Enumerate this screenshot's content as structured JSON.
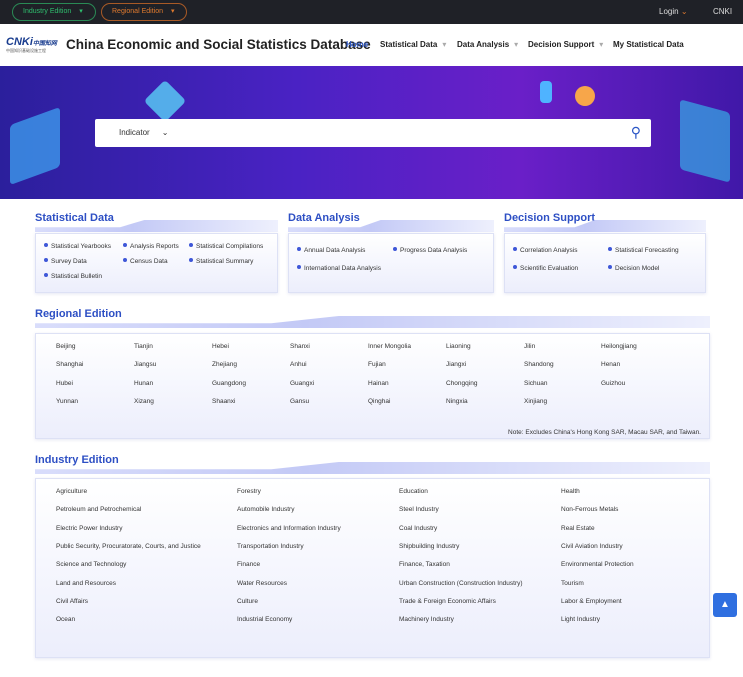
{
  "topbar": {
    "industry_edition": "Industry Edition",
    "regional_edition": "Regional Edition",
    "login": "Login",
    "cnki": "CNKI"
  },
  "header": {
    "logo_text": "CNKi 中国知网",
    "logo_sub": "中国知识基础设施工程",
    "title": "China Economic and Social Statistics Database",
    "nav": [
      {
        "label": "Home"
      },
      {
        "label": "Statistical Data"
      },
      {
        "label": "Data Analysis"
      },
      {
        "label": "Decision Support"
      },
      {
        "label": "My Statistical Data"
      }
    ]
  },
  "search": {
    "selector": "Indicator"
  },
  "statistical_data": {
    "title": "Statistical Data",
    "items": [
      "Statistical Yearbooks",
      "Analysis Reports",
      "Statistical Compilations",
      "Survey Data",
      "Census Data",
      "Statistical Summary",
      "Statistical Bulletin"
    ]
  },
  "data_analysis": {
    "title": "Data Analysis",
    "items": [
      "Annual Data Analysis",
      "Progress Data Analysis",
      "International Data Analysis"
    ]
  },
  "decision_support": {
    "title": "Decision Support",
    "items": [
      "Correlation Analysis",
      "Statistical Forecasting",
      "Scientific Evaluation",
      "Decision Model"
    ]
  },
  "regional": {
    "title": "Regional Edition",
    "items": [
      "Beijing",
      "Tianjin",
      "Hebei",
      "Shanxi",
      "Inner Mongolia",
      "Liaoning",
      "Jilin",
      "Heilongjiang",
      "Shanghai",
      "Jiangsu",
      "Zhejiang",
      "Anhui",
      "Fujian",
      "Jiangxi",
      "Shandong",
      "Henan",
      "Hubei",
      "Hunan",
      "Guangdong",
      "Guangxi",
      "Hainan",
      "Chongqing",
      "Sichuan",
      "Guizhou",
      "Yunnan",
      "Xizang",
      "Shaanxi",
      "Gansu",
      "Qinghai",
      "Ningxia",
      "Xinjiang"
    ],
    "note": "Note: Excludes China's Hong Kong SAR, Macau SAR, and Taiwan."
  },
  "industry": {
    "title": "Industry Edition",
    "items": [
      "Agriculture",
      "Forestry",
      "Education",
      "Health",
      "Petroleum and Petrochemical",
      "Automobile Industry",
      "Steel Industry",
      "Non-Ferrous Metals",
      "Electric Power Industry",
      "Electronics and Information Industry",
      "Coal Industry",
      "Real Estate",
      "Public Security, Procuratorate, Courts, and Justice",
      "Transportation Industry",
      "Shipbuilding Industry",
      "Civil Aviation Industry",
      "Science and Technology",
      "Finance",
      "Finance, Taxation",
      "Environmental Protection",
      "Land and Resources",
      "Water Resources",
      "Urban Construction (Construction Industry)",
      "Tourism",
      "Civil Affairs",
      "Culture",
      "Trade & Foreign Economic Affairs",
      "Labor & Employment",
      "Ocean",
      "Industrial Economy",
      "Machinery Industry",
      "Light Industry"
    ]
  }
}
